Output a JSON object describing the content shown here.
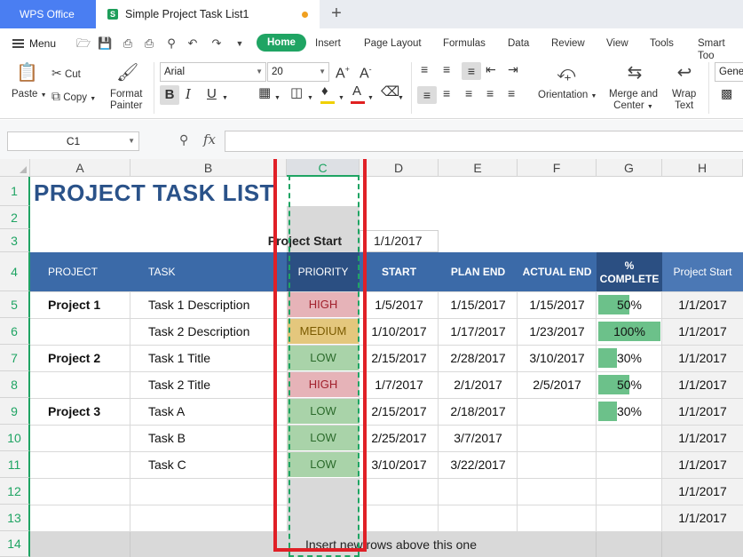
{
  "titlebar": {
    "app_tab": "WPS Office",
    "doc_tab": "Simple Project Task List1",
    "new_tab": "+"
  },
  "menubar": {
    "menu_label": "Menu",
    "tabs": [
      "Home",
      "Insert",
      "Page Layout",
      "Formulas",
      "Data",
      "Review",
      "View",
      "Tools",
      "Smart Too"
    ]
  },
  "ribbon": {
    "paste": "Paste",
    "cut": "Cut",
    "copy": "Copy",
    "format_painter_1": "Format",
    "format_painter_2": "Painter",
    "font_name": "Arial",
    "font_size": "20",
    "orientation": "Orientation",
    "merge_1": "Merge and",
    "merge_2": "Center",
    "wrap_1": "Wrap",
    "wrap_2": "Text",
    "number_format": "Gene",
    "font_color": "#e02020",
    "fill_color": "#f0d000"
  },
  "formula_bar": {
    "name_box": "C1",
    "fx": "fx",
    "formula": ""
  },
  "sheet": {
    "columns": [
      "A",
      "B",
      "C",
      "D",
      "E",
      "F",
      "G",
      "H"
    ],
    "selected_column": "C",
    "rows": [
      "1",
      "2",
      "3",
      "4",
      "5",
      "6",
      "7",
      "8",
      "9",
      "10",
      "11",
      "12",
      "13",
      "14"
    ],
    "title": "PROJECT TASK LIST",
    "project_start_label": "Project Start",
    "project_start_value": "1/1/2017",
    "headers": {
      "project": "PROJECT",
      "task": "TASK",
      "priority": "PRIORITY",
      "start": "START",
      "plan_end": "PLAN END",
      "actual_end": "ACTUAL END",
      "complete_1": "%",
      "complete_2": "COMPLETE",
      "h": "Project Start"
    },
    "data_rows": [
      {
        "project": "Project 1",
        "task": "Task 1 Description",
        "priority": "HIGH",
        "start": "1/5/2017",
        "plan_end": "1/15/2017",
        "actual_end": "1/15/2017",
        "complete": "50%",
        "complete_value": 0.5,
        "h": "1/1/2017"
      },
      {
        "project": "",
        "task": "Task 2 Description",
        "priority": "MEDIUM",
        "start": "1/10/2017",
        "plan_end": "1/17/2017",
        "actual_end": "1/23/2017",
        "complete": "100%",
        "complete_value": 1.0,
        "h": "1/1/2017"
      },
      {
        "project": "Project 2",
        "task": "Task 1 Title",
        "priority": "LOW",
        "start": "2/15/2017",
        "plan_end": "2/28/2017",
        "actual_end": "3/10/2017",
        "complete": "30%",
        "complete_value": 0.3,
        "h": "1/1/2017"
      },
      {
        "project": "",
        "task": "Task 2 Title",
        "priority": "HIGH",
        "start": "1/7/2017",
        "plan_end": "2/1/2017",
        "actual_end": "2/5/2017",
        "complete": "50%",
        "complete_value": 0.5,
        "h": "1/1/2017"
      },
      {
        "project": "Project 3",
        "task": "Task A",
        "priority": "LOW",
        "start": "2/15/2017",
        "plan_end": "2/18/2017",
        "actual_end": "",
        "complete": "30%",
        "complete_value": 0.3,
        "h": "1/1/2017"
      },
      {
        "project": "",
        "task": "Task B",
        "priority": "LOW",
        "start": "2/25/2017",
        "plan_end": "3/7/2017",
        "actual_end": "",
        "complete": "",
        "complete_value": 0,
        "h": "1/1/2017"
      },
      {
        "project": "",
        "task": "Task C",
        "priority": "LOW",
        "start": "3/10/2017",
        "plan_end": "3/22/2017",
        "actual_end": "",
        "complete": "",
        "complete_value": 0,
        "h": "1/1/2017"
      },
      {
        "project": "",
        "task": "",
        "priority": "",
        "start": "",
        "plan_end": "",
        "actual_end": "",
        "complete": "",
        "complete_value": 0,
        "h": "1/1/2017"
      },
      {
        "project": "",
        "task": "",
        "priority": "",
        "start": "",
        "plan_end": "",
        "actual_end": "",
        "complete": "",
        "complete_value": 0,
        "h": "1/1/2017"
      }
    ],
    "footer_text": "Insert new rows above this one",
    "priority_colors": {
      "HIGH": {
        "bg": "#e6b3b8",
        "fg": "#a1202c"
      },
      "MEDIUM": {
        "bg": "#e4c77d",
        "fg": "#7a5a00"
      },
      "LOW": {
        "bg": "#a9d3a9",
        "fg": "#2b6a2b"
      }
    },
    "header_color": "#3b6aa8",
    "title_color": "#2a5289",
    "highlight_color": "#e02027",
    "selection_color": "#1fa463"
  }
}
